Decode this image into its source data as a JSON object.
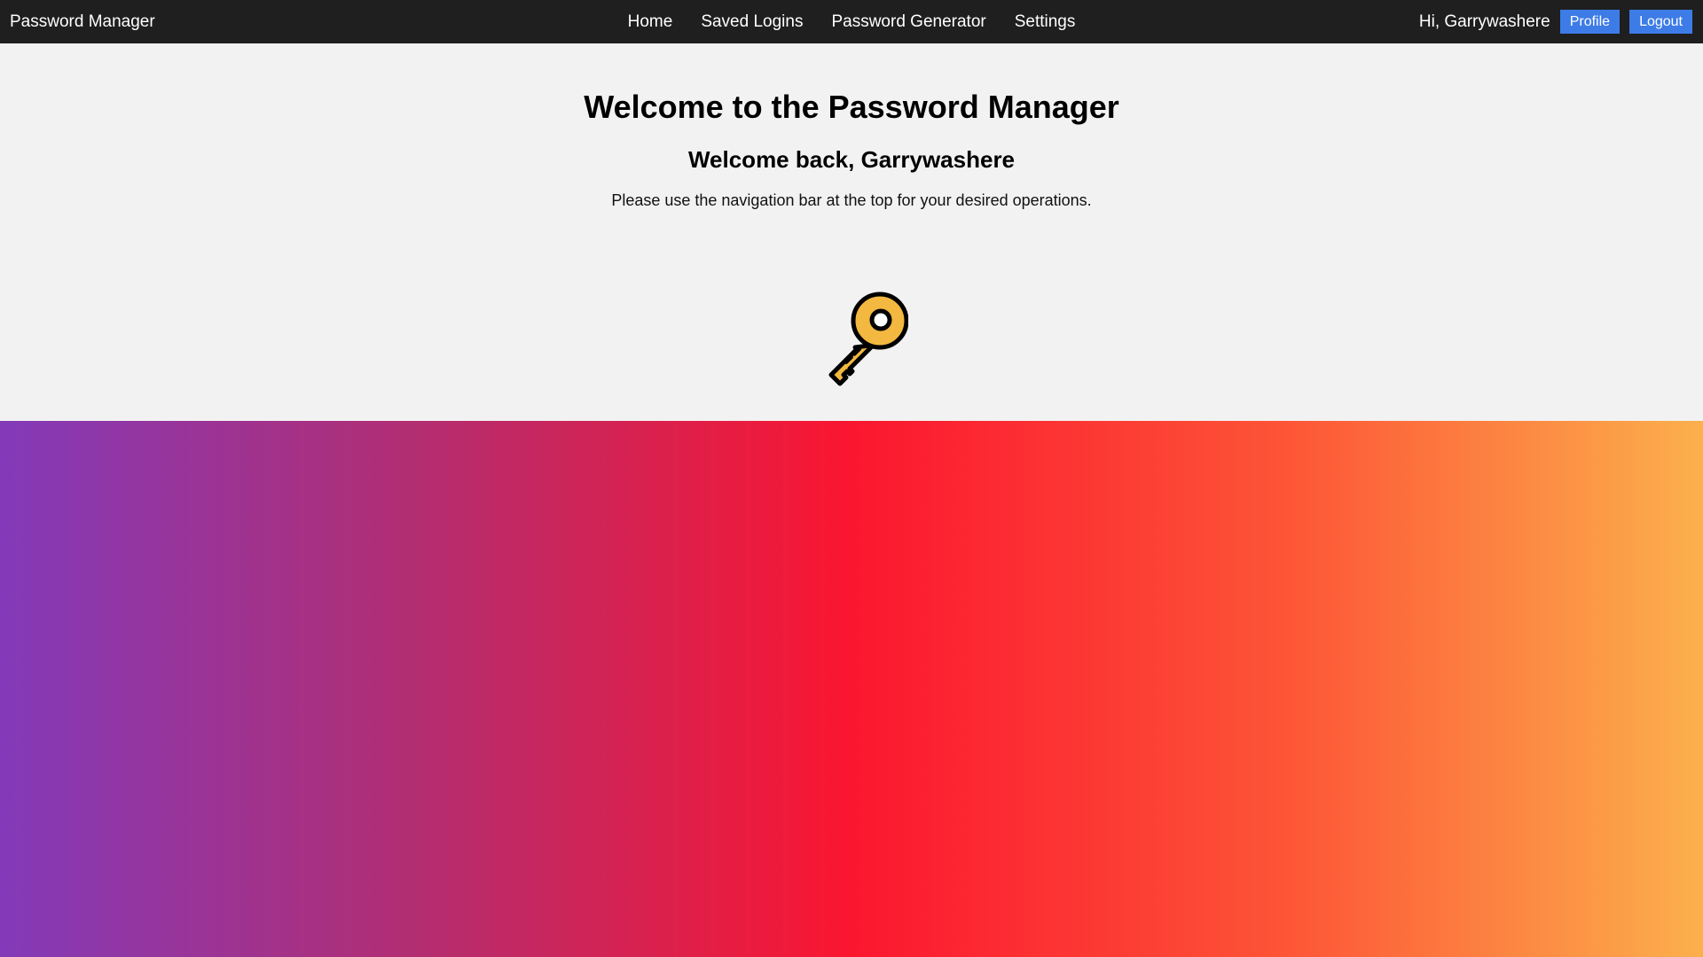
{
  "navbar": {
    "brand": "Password Manager",
    "links": [
      {
        "label": "Home"
      },
      {
        "label": "Saved Logins"
      },
      {
        "label": "Password Generator"
      },
      {
        "label": "Settings"
      }
    ],
    "greeting": "Hi, Garrywashere",
    "profile_label": "Profile",
    "logout_label": "Logout"
  },
  "main": {
    "title": "Welcome to the Password Manager",
    "subtitle": "Welcome back, Garrywashere",
    "description": "Please use the navigation bar at the top for your desired operations.",
    "icon": "key-icon"
  },
  "colors": {
    "navbar_bg": "#1f1f1f",
    "page_bg": "#f2f2f2",
    "button_accent": "#3d7ce6",
    "key_fill": "#f2b83f",
    "gradient_stops": [
      "#833ab9",
      "#b42d70",
      "#fb1630",
      "#fd5336",
      "#fcb04c"
    ]
  }
}
